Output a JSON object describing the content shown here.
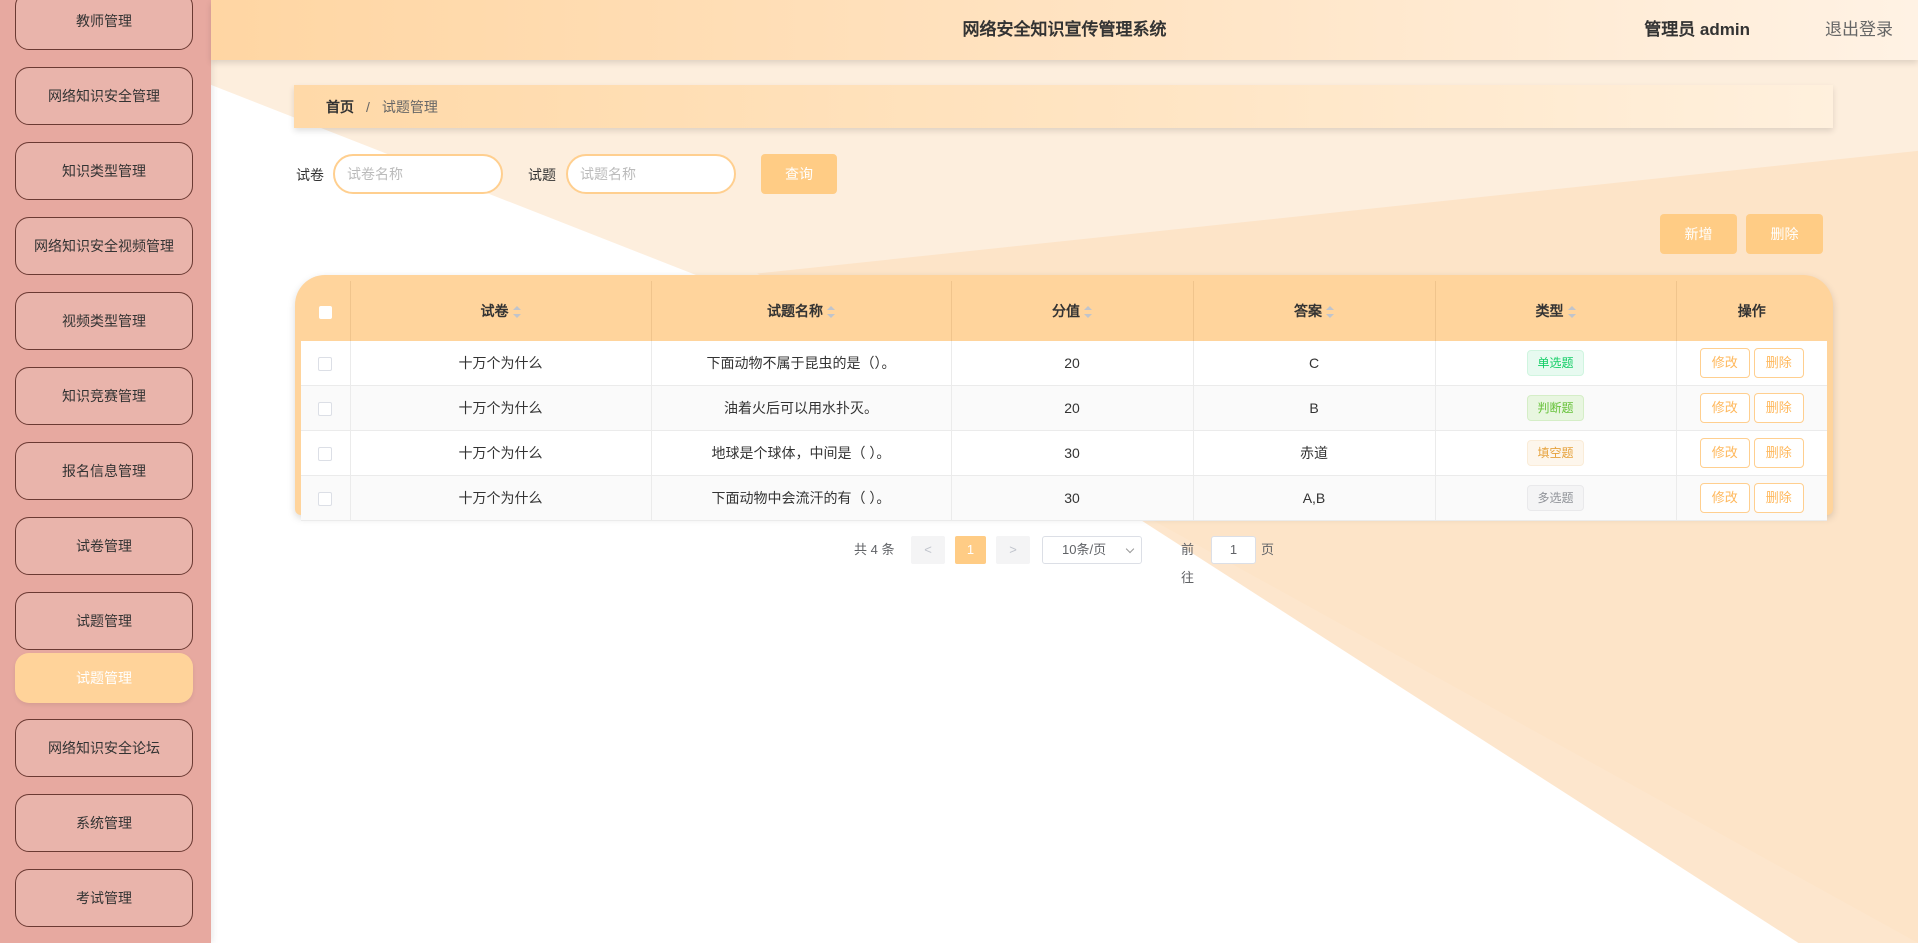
{
  "header": {
    "title": "网络安全知识宣传管理系统",
    "user": "管理员 admin",
    "logout": "退出登录"
  },
  "sidebar": {
    "items": [
      {
        "label": "教师管理"
      },
      {
        "label": "网络知识安全管理"
      },
      {
        "label": "知识类型管理"
      },
      {
        "label": "网络知识安全视频管理"
      },
      {
        "label": "视频类型管理"
      },
      {
        "label": "知识竞赛管理"
      },
      {
        "label": "报名信息管理"
      },
      {
        "label": "试卷管理"
      },
      {
        "label": "试题管理"
      },
      {
        "label": "试题管理",
        "active": true
      },
      {
        "label": "网络知识安全论坛"
      },
      {
        "label": "系统管理"
      },
      {
        "label": "考试管理"
      }
    ]
  },
  "breadcrumb": {
    "home": "首页",
    "separator": "/",
    "current": "试题管理"
  },
  "search": {
    "paper_label": "试卷",
    "paper_placeholder": "试卷名称",
    "question_label": "试题",
    "question_placeholder": "试题名称",
    "query_button": "查询"
  },
  "actions": {
    "add": "新增",
    "delete": "删除"
  },
  "table": {
    "columns": [
      "试卷",
      "试题名称",
      "分值",
      "答案",
      "类型",
      "操作"
    ],
    "rows": [
      {
        "paper": "十万个为什么",
        "question": "下面动物不属于昆虫的是（）。",
        "score": "20",
        "answer": "C",
        "type": "单选题",
        "type_style": "success"
      },
      {
        "paper": "十万个为什么",
        "question": "油着火后可以用水扑灭。",
        "score": "20",
        "answer": "B",
        "type": "判断题",
        "type_style": "green"
      },
      {
        "paper": "十万个为什么",
        "question": "地球是个球体，中间是（ ）。",
        "score": "30",
        "answer": "赤道",
        "type": "填空题",
        "type_style": "warning"
      },
      {
        "paper": "十万个为什么",
        "question": "下面动物中会流汗的有（ ）。",
        "score": "30",
        "answer": "A,B",
        "type": "多选题",
        "type_style": "info"
      }
    ],
    "edit_label": "修改",
    "delete_label": "删除"
  },
  "pagination": {
    "total": "共 4 条",
    "prev": "<",
    "page": "1",
    "next": ">",
    "page_size": "10条/页",
    "goto_label": "前往",
    "goto_value": "1",
    "goto_unit": "页"
  },
  "colors": {
    "accent": "#ffcc85",
    "sidebar_bg": "#e7a9a0",
    "sidebar_item_border": "#6b3a33"
  }
}
